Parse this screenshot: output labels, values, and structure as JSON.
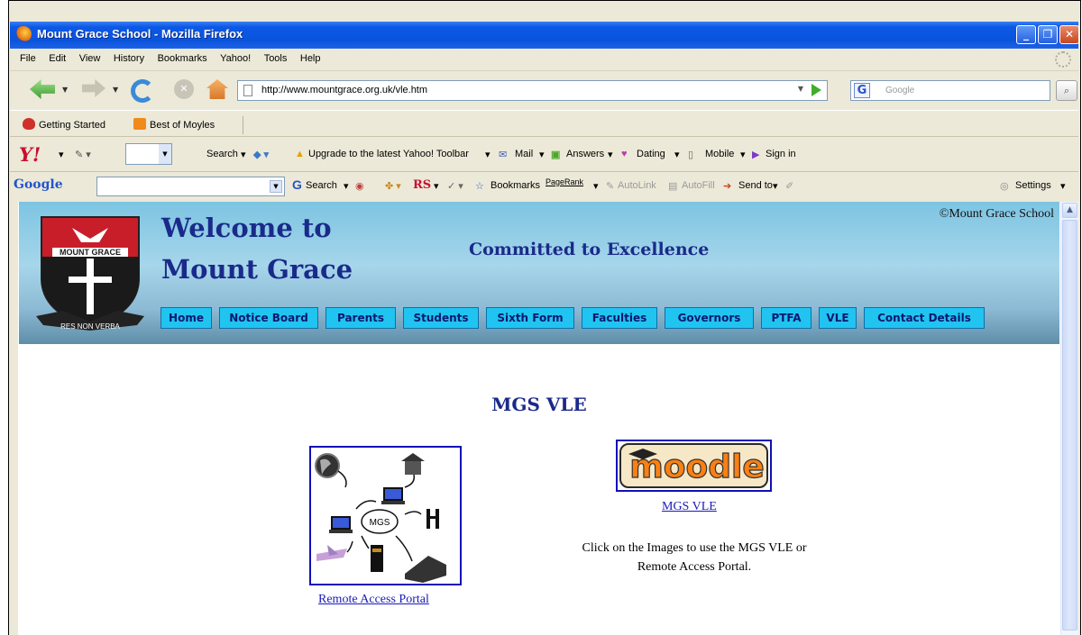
{
  "window": {
    "title": "Mount Grace School - Mozilla Firefox"
  },
  "menu": [
    "File",
    "Edit",
    "View",
    "History",
    "Bookmarks",
    "Yahoo!",
    "Tools",
    "Help"
  ],
  "nav": {
    "url": "http://www.mountgrace.org.uk/vle.htm",
    "search_placeholder": "Google"
  },
  "bookmarks": [
    "Getting Started",
    "Best of Moyles"
  ],
  "yahoo_toolbar": {
    "logo": "Y!",
    "search_label": "Search",
    "upgrade_label": "Upgrade to the latest Yahoo! Toolbar",
    "mail_label": "Mail",
    "answers_label": "Answers",
    "dating_label": "Dating",
    "mobile_label": "Mobile",
    "signin_label": "Sign in"
  },
  "google_toolbar": {
    "logo": "Google",
    "search_label": "Search",
    "rs_label": "RS",
    "bookmarks_label": "Bookmarks",
    "pagerank_label": "PageRank",
    "autolink_label": "AutoLink",
    "autofill_label": "AutoFill",
    "sendto_label": "Send to",
    "settings_label": "Settings"
  },
  "site": {
    "copyright": "©Mount Grace School",
    "welcome_line1": "Welcome to",
    "welcome_line2": "Mount Grace",
    "motto": "Committed to Excellence",
    "crest_name": "MOUNT GRACE",
    "crest_motto": "RES NON VERBA",
    "nav": [
      "Home",
      "Notice Board",
      "Parents",
      "Students",
      "Sixth Form",
      "Faculties",
      "Governors",
      "PTFA",
      "VLE",
      "Contact Details"
    ]
  },
  "content": {
    "heading": "MGS VLE",
    "portal_center_label": "MGS",
    "portal_link": "Remote Access Portal",
    "moodle_logo_text": "moodle",
    "moodle_link": "MGS VLE",
    "info_line1": "Click on the Images to use the MGS VLE or",
    "info_line2": "Remote Access Portal."
  },
  "colors": {
    "titlebar": "#0a54dc",
    "banner_top": "#7dc4e2",
    "nav_button": "#21c4f1",
    "heading_text": "#1a2a8a",
    "link": "#1a1ab8",
    "moodle_orange": "#f98012"
  }
}
